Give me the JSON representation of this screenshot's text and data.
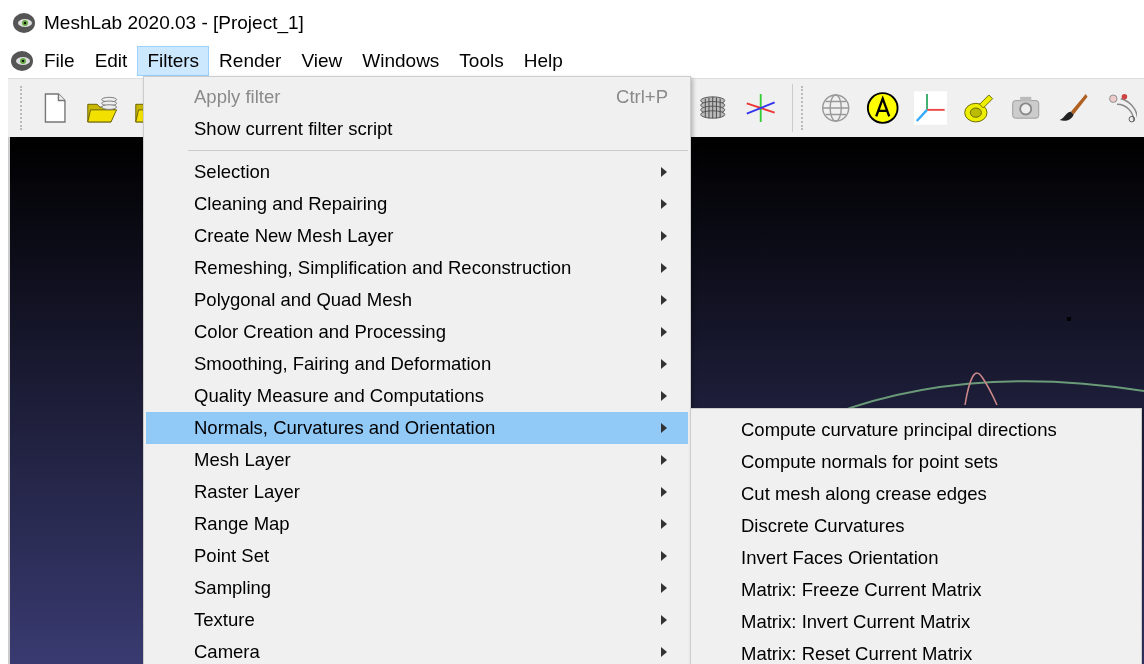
{
  "window": {
    "title": "MeshLab 2020.03 - [Project_1]"
  },
  "menu_bar": [
    {
      "label": "File",
      "selected": false
    },
    {
      "label": "Edit",
      "selected": false
    },
    {
      "label": "Filters",
      "selected": true
    },
    {
      "label": "Render",
      "selected": false
    },
    {
      "label": "View",
      "selected": false
    },
    {
      "label": "Windows",
      "selected": false
    },
    {
      "label": "Tools",
      "selected": false
    },
    {
      "label": "Help",
      "selected": false
    }
  ],
  "filters_menu": {
    "items": [
      {
        "kind": "action",
        "label": "Apply filter",
        "shortcut": "Ctrl+P",
        "disabled": true
      },
      {
        "kind": "action",
        "label": "Show current filter script",
        "disabled": false
      },
      {
        "kind": "separator"
      },
      {
        "kind": "submenu",
        "label": "Selection",
        "selected": false
      },
      {
        "kind": "submenu",
        "label": "Cleaning and Repairing",
        "selected": false
      },
      {
        "kind": "submenu",
        "label": "Create New Mesh Layer",
        "selected": false
      },
      {
        "kind": "submenu",
        "label": "Remeshing, Simplification and Reconstruction",
        "selected": false
      },
      {
        "kind": "submenu",
        "label": "Polygonal and Quad Mesh",
        "selected": false
      },
      {
        "kind": "submenu",
        "label": "Color Creation and Processing",
        "selected": false
      },
      {
        "kind": "submenu",
        "label": "Smoothing, Fairing and Deformation",
        "selected": false
      },
      {
        "kind": "submenu",
        "label": "Quality Measure and Computations",
        "selected": false
      },
      {
        "kind": "submenu",
        "label": "Normals, Curvatures and Orientation",
        "selected": true
      },
      {
        "kind": "submenu",
        "label": "Mesh Layer",
        "selected": false
      },
      {
        "kind": "submenu",
        "label": "Raster Layer",
        "selected": false
      },
      {
        "kind": "submenu",
        "label": "Range Map",
        "selected": false
      },
      {
        "kind": "submenu",
        "label": "Point Set",
        "selected": false
      },
      {
        "kind": "submenu",
        "label": "Sampling",
        "selected": false
      },
      {
        "kind": "submenu",
        "label": "Texture",
        "selected": false
      },
      {
        "kind": "submenu",
        "label": "Camera",
        "selected": false
      }
    ]
  },
  "submenu": {
    "items": [
      {
        "label": "Compute curvature principal directions"
      },
      {
        "label": "Compute normals for point sets"
      },
      {
        "label": "Cut mesh along crease edges"
      },
      {
        "label": "Discrete Curvatures"
      },
      {
        "label": "Invert Faces Orientation"
      },
      {
        "label": "Matrix: Freeze Current Matrix"
      },
      {
        "label": "Matrix: Invert Current Matrix"
      },
      {
        "label": "Matrix: Reset Current Matrix"
      }
    ]
  }
}
